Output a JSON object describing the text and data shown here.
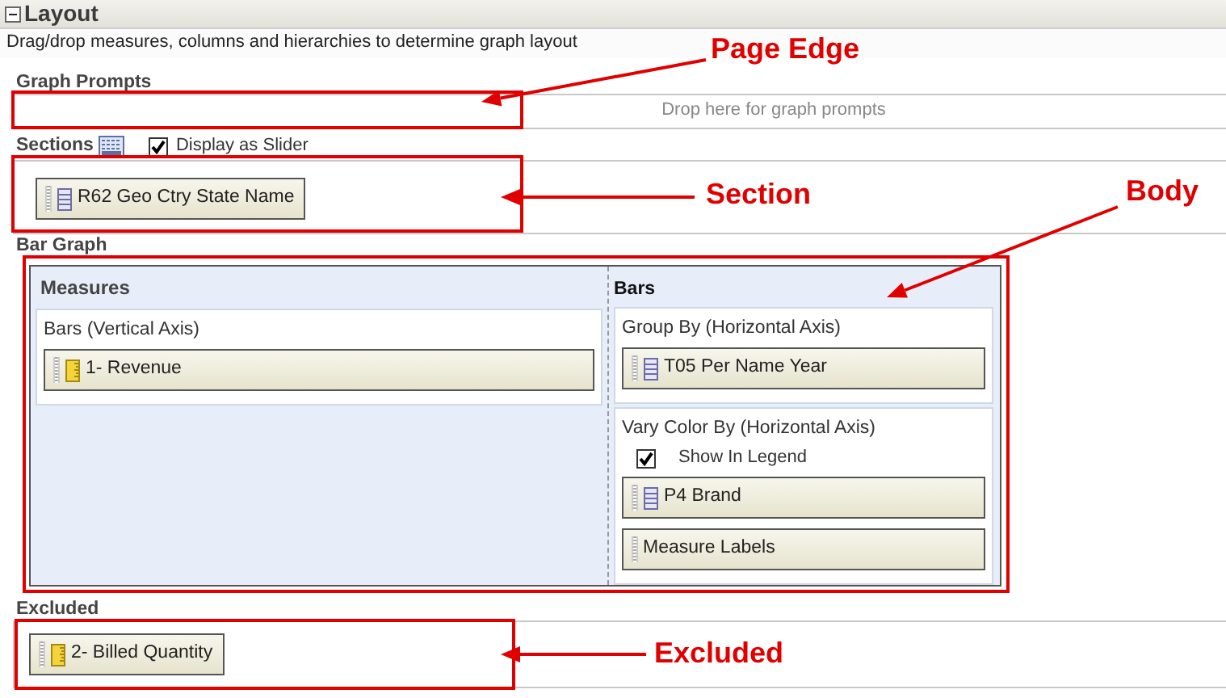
{
  "panel": {
    "title": "Layout",
    "expanded": true
  },
  "description": "Drag/drop measures, columns and hierarchies to determine graph layout",
  "graph_prompts": {
    "label": "Graph Prompts",
    "placeholder": "Drop here for graph prompts"
  },
  "sections": {
    "label": "Sections",
    "display_as_slider": {
      "label": "Display as Slider",
      "checked": true
    },
    "items": [
      {
        "label": "R62 Geo Ctry State Name",
        "kind": "attribute"
      }
    ]
  },
  "bar_graph": {
    "label": "Bar Graph",
    "measures": {
      "title": "Measures",
      "groups": [
        {
          "title": "Bars (Vertical Axis)",
          "items": [
            {
              "label": "1- Revenue",
              "kind": "measure"
            }
          ]
        }
      ]
    },
    "bars": {
      "title": "Bars",
      "groups": [
        {
          "title": "Group By (Horizontal Axis)",
          "items": [
            {
              "label": "T05 Per Name Year",
              "kind": "attribute"
            }
          ]
        },
        {
          "title": "Vary Color By (Horizontal Axis)",
          "show_in_legend": {
            "label": "Show In Legend",
            "checked": true
          },
          "items": [
            {
              "label": "P4 Brand",
              "kind": "attribute"
            },
            {
              "label": "Measure Labels",
              "kind": "plain"
            }
          ]
        }
      ]
    }
  },
  "excluded": {
    "label": "Excluded",
    "items": [
      {
        "label": "2- Billed Quantity",
        "kind": "measure"
      }
    ]
  },
  "annotations": [
    {
      "label": "Page Edge"
    },
    {
      "label": "Section"
    },
    {
      "label": "Body"
    },
    {
      "label": "Excluded"
    }
  ]
}
